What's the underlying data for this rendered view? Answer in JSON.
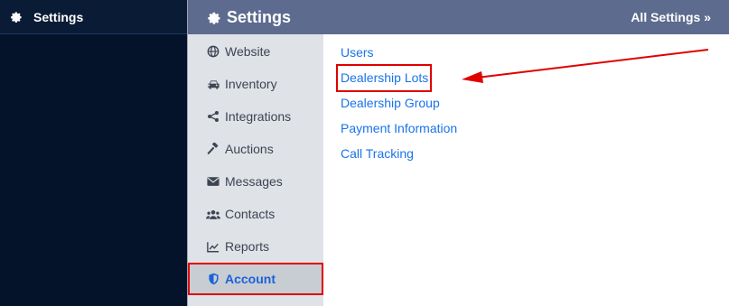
{
  "left_nav": {
    "title": "Settings"
  },
  "topbar": {
    "title": "Settings",
    "all_settings": "All Settings »"
  },
  "subnav": {
    "items": [
      {
        "label": "Website"
      },
      {
        "label": "Inventory"
      },
      {
        "label": "Integrations"
      },
      {
        "label": "Auctions"
      },
      {
        "label": "Messages"
      },
      {
        "label": "Contacts"
      },
      {
        "label": "Reports"
      },
      {
        "label": "Account"
      }
    ]
  },
  "content": {
    "links": [
      {
        "label": "Users"
      },
      {
        "label": "Dealership Lots"
      },
      {
        "label": "Dealership Group"
      },
      {
        "label": "Payment Information"
      },
      {
        "label": "Call Tracking"
      }
    ]
  },
  "colors": {
    "sidebar": "#041329",
    "topbar": "#5c6b8e",
    "link": "#1a73e8",
    "highlight": "#e00000"
  }
}
